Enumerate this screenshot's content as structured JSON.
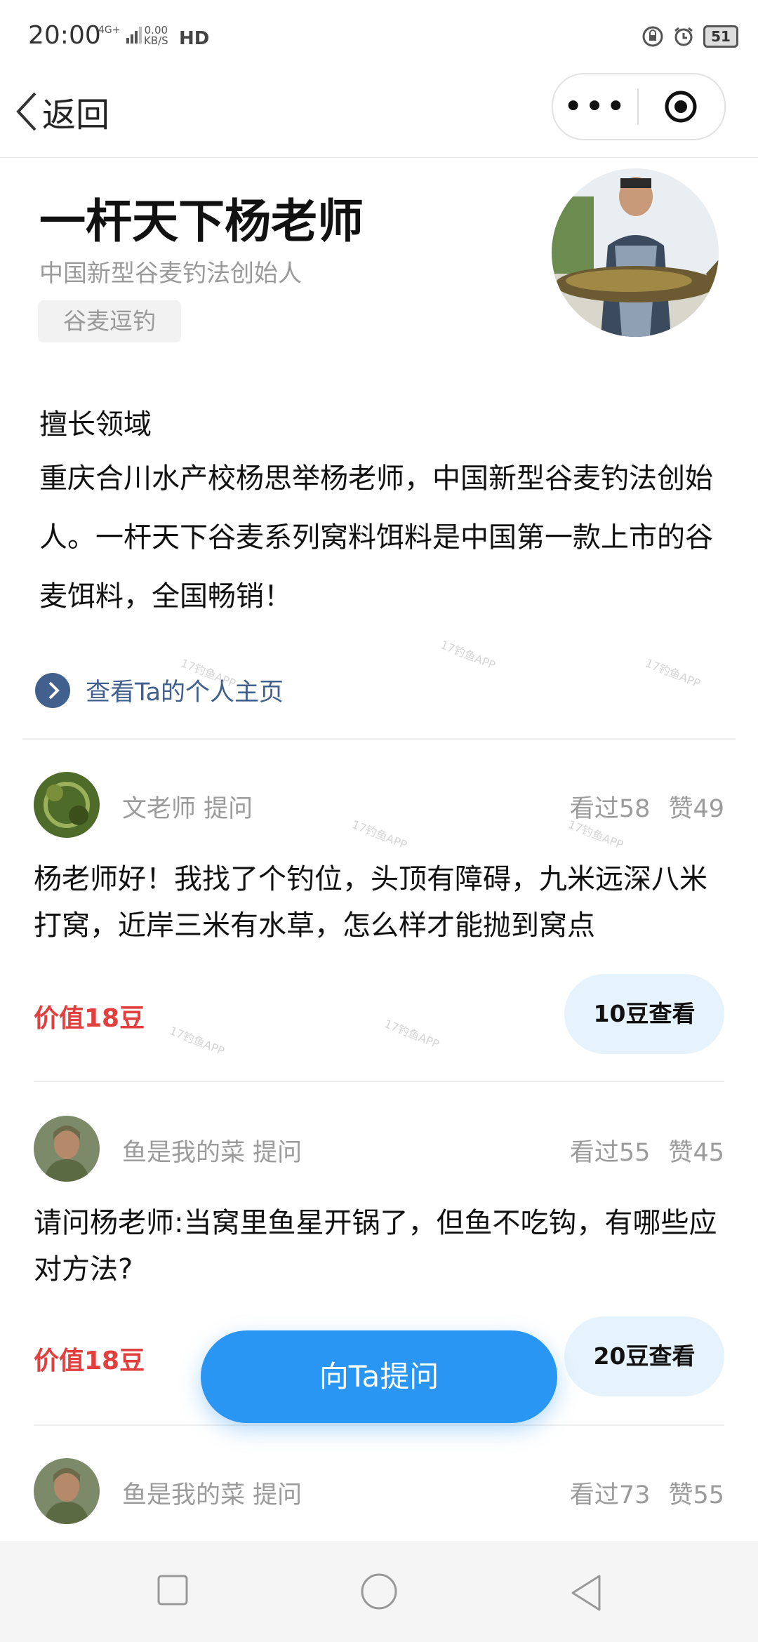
{
  "status_bar": {
    "time": "20:00",
    "network": "4G+",
    "speed_value": "0.00",
    "speed_unit": "KB/S",
    "hd": "HD",
    "battery": "51"
  },
  "nav": {
    "back_label": "返回",
    "more_icon": "more-dots-icon",
    "target_icon": "target-icon"
  },
  "profile": {
    "name": "一杆天下杨老师",
    "subtitle": "中国新型谷麦钓法创始人",
    "tag": "谷麦逗钓",
    "expertise_heading": "擅长领域",
    "expertise_text": "重庆合川水产校杨思举杨老师，中国新型谷麦钓法创始人。一杆天下谷麦系列窝料饵料是中国第一款上市的谷麦饵料，全国畅销！",
    "homepage_link": "查看Ta的个人主页"
  },
  "questions": [
    {
      "asker": "文老师 提问",
      "views": "看过58",
      "likes": "赞49",
      "text": "杨老师好！我找了个钓位，头顶有障碍，九米远深八米打窝，近岸三米有水草，怎么样才能抛到窝点",
      "value": "价值18豆",
      "button": "10豆查看"
    },
    {
      "asker": "鱼是我的菜 提问",
      "views": "看过55",
      "likes": "赞45",
      "text": "请问杨老师:当窝里鱼星开锅了，但鱼不吃钩，有哪些应对方法?",
      "value": "价值18豆",
      "button": "20豆查看"
    },
    {
      "asker": "鱼是我的菜 提问",
      "views": "看过73",
      "likes": "赞55"
    }
  ],
  "ask_button": "向Ta提问",
  "watermark_text": "17钓鱼APP",
  "colors": {
    "accent_blue": "#2a96f3",
    "value_red": "#e2403e",
    "link_blue": "#41608e",
    "button_bg": "#e7f3fc"
  }
}
